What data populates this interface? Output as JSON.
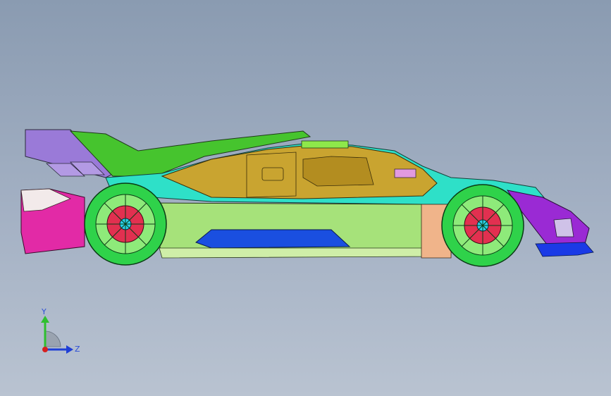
{
  "viewport": {
    "background_top": "#8a9bb1",
    "background_bottom": "#b9c3d1"
  },
  "model": {
    "view": "side"
  },
  "triad": {
    "y_label": "Y",
    "z_label": "Z",
    "y_color": "#2fbf2f",
    "z_color": "#1f3fd6",
    "x_color": "#d62020"
  }
}
